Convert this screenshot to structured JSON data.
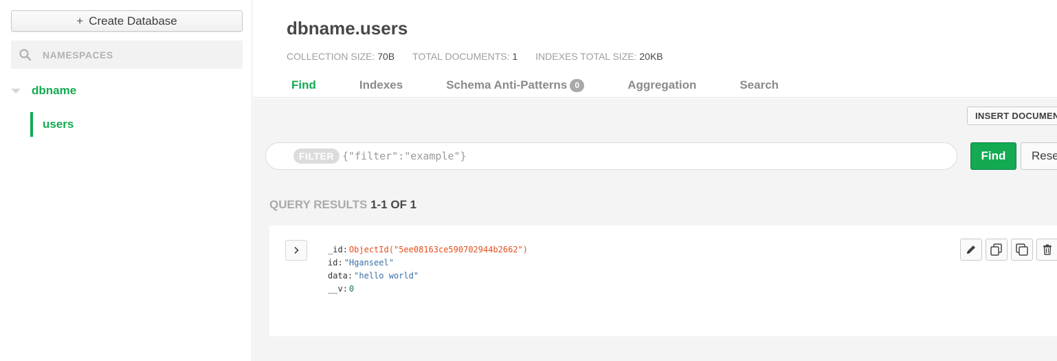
{
  "sidebar": {
    "create_database_label": "Create Database",
    "search_placeholder": "NAMESPACES",
    "databases": [
      {
        "name": "dbname",
        "collections": [
          "users"
        ]
      }
    ]
  },
  "header": {
    "title": "dbname.users",
    "stats": [
      {
        "label": "COLLECTION SIZE:",
        "value": "70B"
      },
      {
        "label": "TOTAL DOCUMENTS:",
        "value": "1"
      },
      {
        "label": "INDEXES TOTAL SIZE:",
        "value": "20KB"
      }
    ],
    "tabs": [
      {
        "label": "Find",
        "active": true
      },
      {
        "label": "Indexes"
      },
      {
        "label": "Schema Anti-Patterns",
        "badge": "0"
      },
      {
        "label": "Aggregation"
      },
      {
        "label": "Search"
      }
    ]
  },
  "main": {
    "insert_document_label": "INSERT DOCUMENT",
    "filter_label": "FILTER",
    "filter_placeholder": "{\"filter\":\"example\"}",
    "find_label": "Find",
    "reset_label": "Reset",
    "results_label": "QUERY RESULTS",
    "results_count": "1-1 OF 1",
    "document": {
      "fields": [
        {
          "key": "_id",
          "value": "ObjectId(\"5ee08163ce590702944b2662\")",
          "type": "objectid"
        },
        {
          "key": "id",
          "value": "\"Hganseel\"",
          "type": "string"
        },
        {
          "key": "data",
          "value": "\"hello world\"",
          "type": "string"
        },
        {
          "key": "__v",
          "value": "0",
          "type": "number"
        }
      ]
    }
  },
  "colors": {
    "accent_green": "#13aa52",
    "objectid": "#e24e1b",
    "string": "#3a6fa6"
  }
}
